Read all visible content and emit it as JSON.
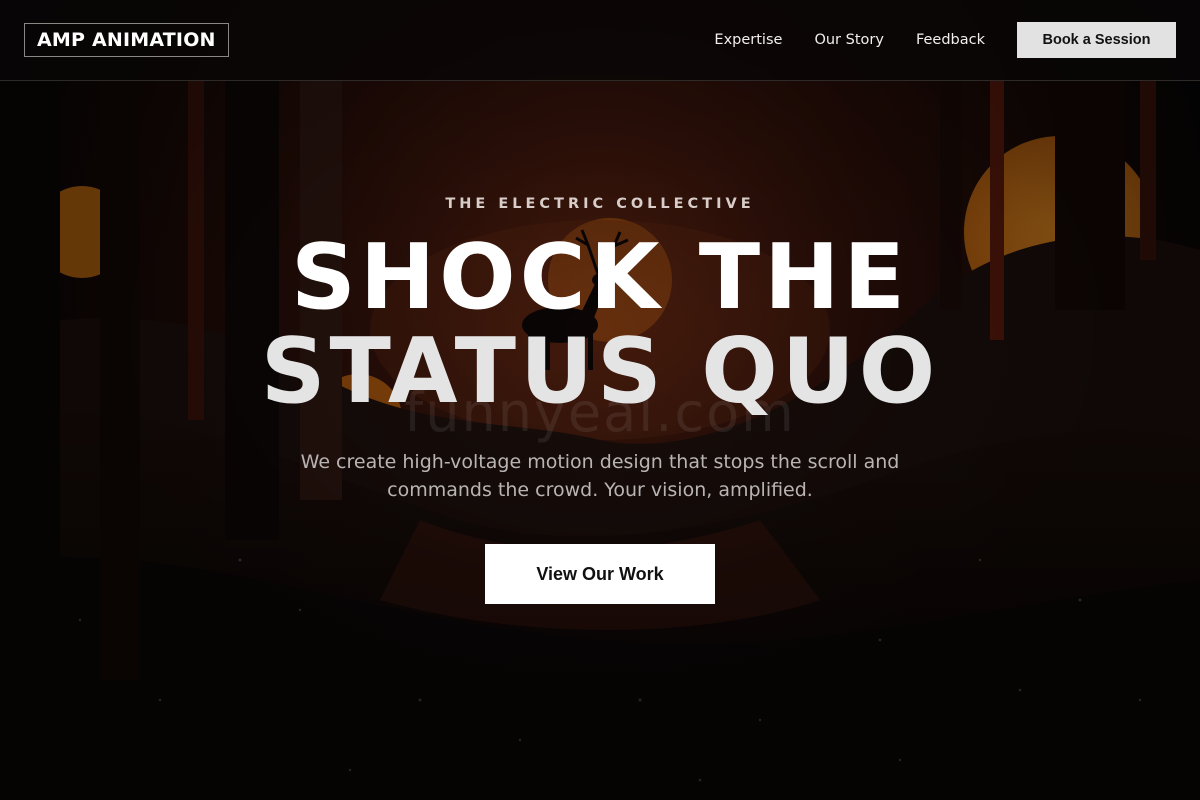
{
  "nav": {
    "logo": "AMP ANIMATION",
    "links": [
      {
        "label": "Expertise"
      },
      {
        "label": "Our Story"
      },
      {
        "label": "Feedback"
      }
    ],
    "cta_label": "Book a Session"
  },
  "hero": {
    "eyebrow": "THE ELECTRIC COLLECTIVE",
    "headline_line1": "SHOCK THE",
    "headline_line2": "STATUS QUO",
    "subtitle": "We create high-voltage motion design that stops the scroll and commands the crowd. Your vision, amplified.",
    "cta_label": "View Our Work",
    "watermark": "funnyeal.com"
  },
  "colors": {
    "background": "#0b0706",
    "accent_orange": "#c9731a",
    "cta_background": "#ffffff",
    "nav_cta_background": "#e2e2e2"
  }
}
